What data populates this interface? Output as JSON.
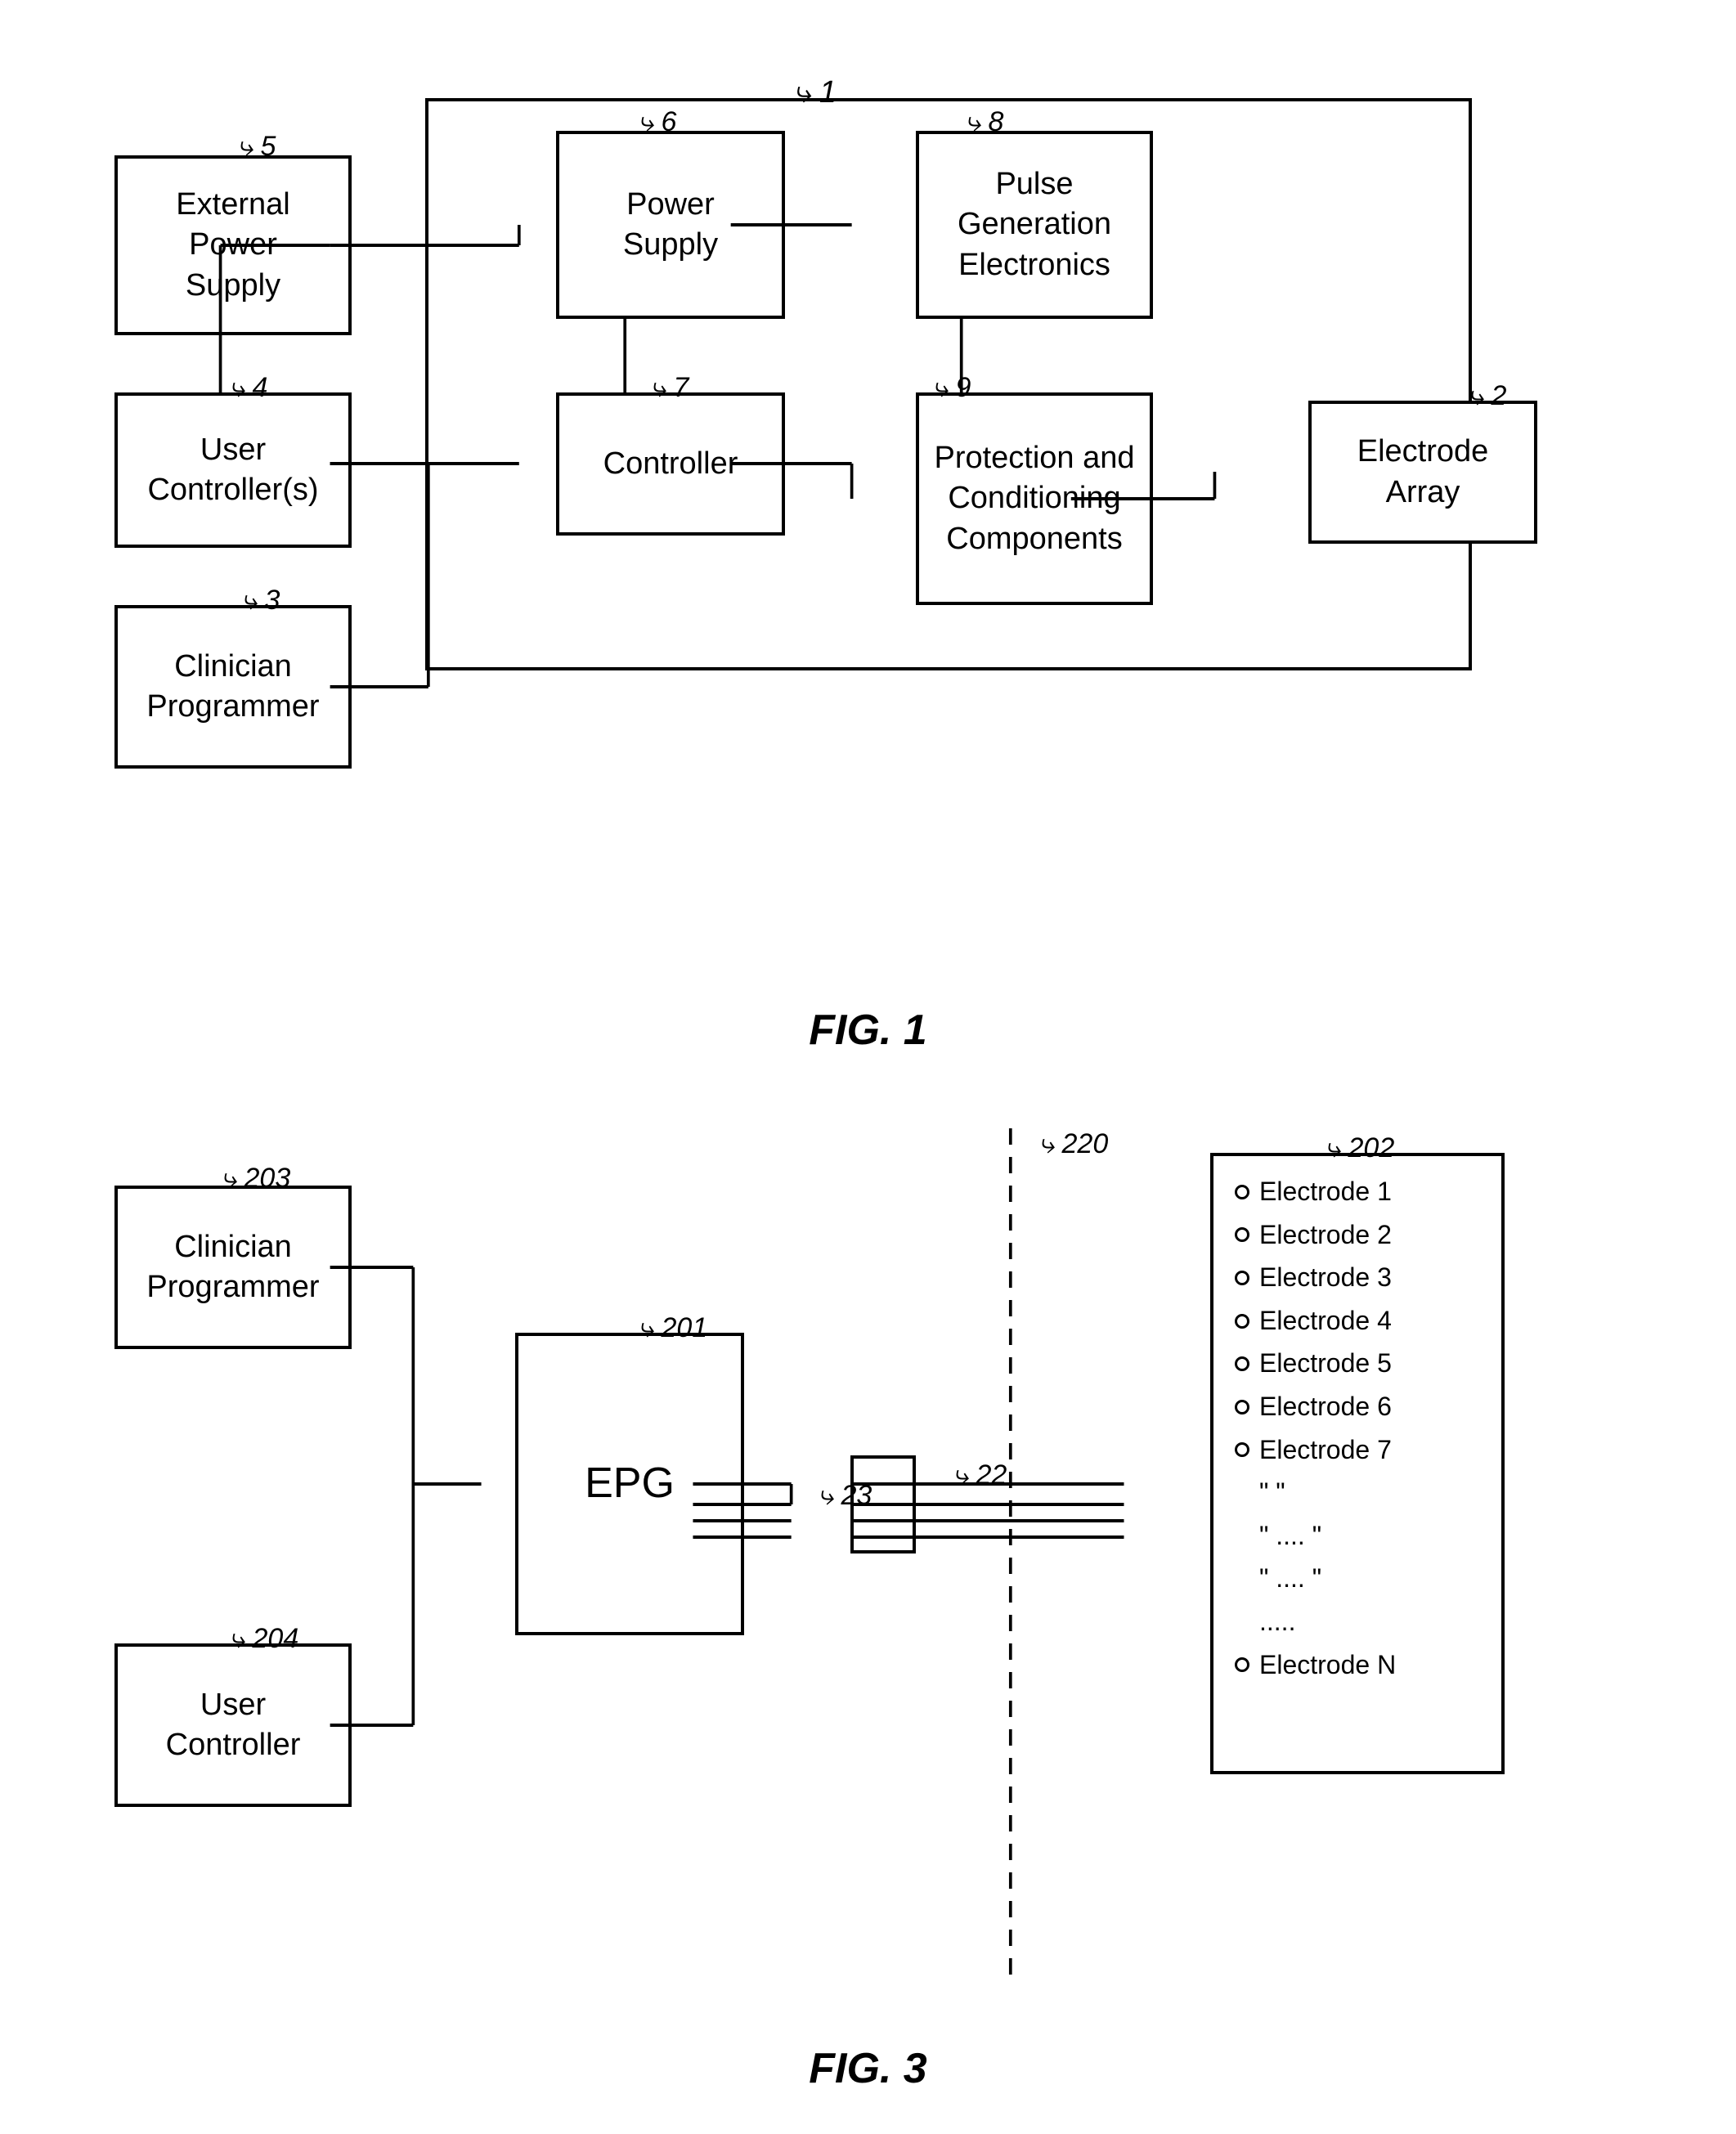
{
  "fig1": {
    "label": "FIG. 1",
    "outer_ref": "1",
    "boxes": {
      "b1_ref": "1",
      "b2_label": "Electrode\nArray",
      "b2_ref": "2",
      "b3_label": "Clinician\nProgrammer",
      "b3_ref": "3",
      "b4_label": "User\nController(s)",
      "b4_ref": "4",
      "b5_label": "External\nPower\nSupply",
      "b5_ref": "5",
      "b6_label": "Power\nSupply",
      "b6_ref": "6",
      "b7_label": "Controller",
      "b7_ref": "7",
      "b8_label": "Pulse\nGeneration\nElectronics",
      "b8_ref": "8",
      "b9_label": "Protection and\nConditioning\nComponents",
      "b9_ref": "9"
    }
  },
  "fig3": {
    "label": "FIG. 3",
    "boxes": {
      "b201_label": "EPG",
      "b201_ref": "201",
      "b202_ref": "202",
      "b203_label": "Clinician\nProgrammer",
      "b203_ref": "203",
      "b204_label": "User\nController",
      "b204_ref": "204",
      "b23_ref": "23",
      "b22_ref": "22",
      "b220_ref": "220"
    },
    "electrodes": [
      "Electrode  1",
      "Electrode  2",
      "Electrode  3",
      "Electrode  4",
      "Electrode  5",
      "Electrode  6",
      "Electrode  7",
      "\"    \"",
      "\"  ....  \"",
      "\"  ....  \"",
      ".....",
      "Electrode  N"
    ]
  }
}
